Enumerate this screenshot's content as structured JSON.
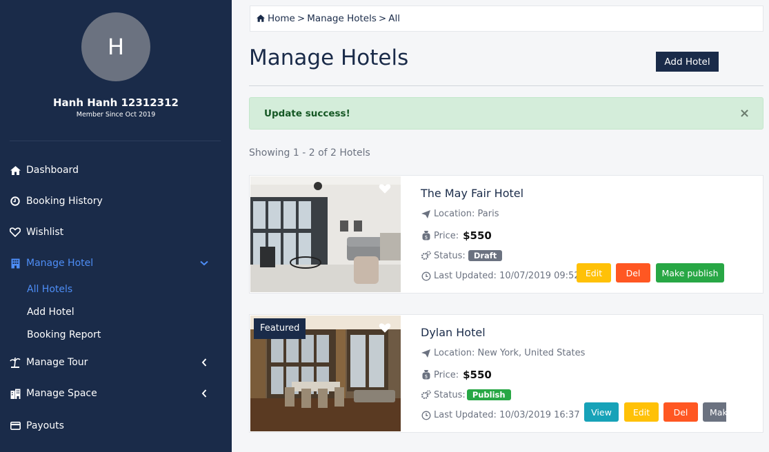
{
  "user": {
    "initial": "H",
    "name": "Hanh Hanh 12312312",
    "member_since": "Member Since Oct 2019"
  },
  "sidebar": {
    "items": [
      {
        "label": "Dashboard",
        "icon": "home-icon"
      },
      {
        "label": "Booking History",
        "icon": "clock-icon"
      },
      {
        "label": "Wishlist",
        "icon": "heart-icon"
      },
      {
        "label": "Manage Hotel",
        "icon": "building-icon"
      },
      {
        "label": "Manage Tour",
        "icon": "beach-icon"
      },
      {
        "label": "Manage Space",
        "icon": "building-icon"
      },
      {
        "label": "Payouts",
        "icon": "card-icon"
      }
    ],
    "sub_items": [
      {
        "label": "All Hotels"
      },
      {
        "label": "Add Hotel"
      },
      {
        "label": "Booking Report"
      }
    ]
  },
  "breadcrumb": {
    "home": "Home",
    "sep": ">",
    "section": "Manage Hotels",
    "current": "All"
  },
  "page": {
    "title": "Manage Hotels",
    "add_button": "Add Hotel",
    "alert": "Update success!",
    "alert_close": "×",
    "showing": "Showing 1 - 2 of 2 Hotels"
  },
  "hotels": [
    {
      "name": "The May Fair Hotel",
      "location_label": "Location:",
      "location": "Paris",
      "price_label": "Price:",
      "price": "$550",
      "status_label": "Status:",
      "status": "Draft",
      "updated_label": "Last Updated:",
      "updated": "10/07/2019 09:52",
      "buttons": {
        "edit": "Edit",
        "del": "Del",
        "publish": "Make publish"
      }
    },
    {
      "name": "Dylan Hotel",
      "featured": "Featured",
      "location_label": "Location:",
      "location": "New York, United States",
      "price_label": "Price:",
      "price": "$550",
      "status_label": "Status:",
      "status": "Publish",
      "updated_label": "Last Updated:",
      "updated": "10/03/2019 16:37",
      "buttons": {
        "view": "View",
        "edit": "Edit",
        "del": "Del",
        "more": "Mak"
      }
    }
  ],
  "colors": {
    "sidebar_bg": "#1a2b49",
    "active": "#4e8ef7",
    "alert_bg": "#d4edda",
    "edit": "#ffc107",
    "del": "#ff5722",
    "publish": "#28a745",
    "view": "#17a2b8"
  }
}
